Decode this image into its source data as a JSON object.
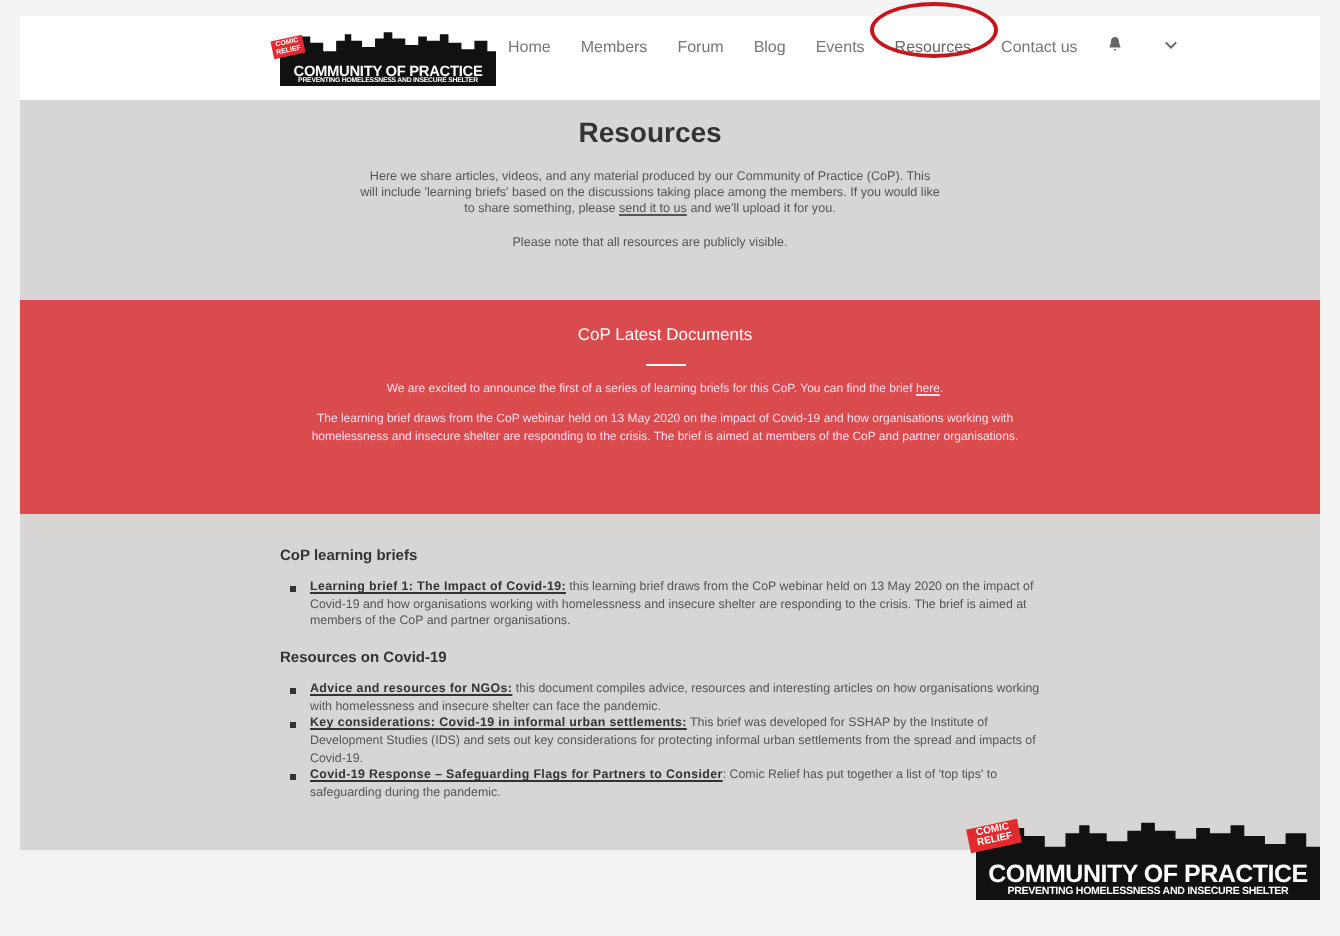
{
  "header": {
    "logo": {
      "badge": "COMIC RELIEF",
      "title": "COMMUNITY OF PRACTICE",
      "subtitle": "PREVENTING HOMELESSNESS AND INSECURE SHELTER"
    },
    "nav": [
      {
        "label": "Home",
        "selected": false,
        "circled": false
      },
      {
        "label": "Members",
        "selected": false,
        "circled": false
      },
      {
        "label": "Forum",
        "selected": false,
        "circled": false
      },
      {
        "label": "Blog",
        "selected": false,
        "circled": false
      },
      {
        "label": "Events",
        "selected": false,
        "circled": false
      },
      {
        "label": "Resources",
        "selected": true,
        "circled": true
      },
      {
        "label": "Contact us",
        "selected": false,
        "circled": false
      }
    ]
  },
  "intro": {
    "title": "Resources",
    "paragraph": {
      "before": "Here we share articles, videos, and any material produced by our Community of Practice (CoP). This will include 'learning briefs' based on the discussions taking place among the members. If you would like to share something, please ",
      "link": "send it to us",
      "after": " and we'll upload it for you."
    },
    "note": "Please note that all resources are publicly visible."
  },
  "banner": {
    "title": "CoP Latest Documents",
    "announcement": {
      "before": "We are excited to announce the first of a series of learning briefs for this CoP. You can find the brief ",
      "link": "here",
      "after": "."
    },
    "description": "The learning brief draws from the CoP webinar held on 13 May 2020 on the impact of Covid-19 and how organisations working with homelessness and insecure shelter are responding to the crisis. The brief is aimed at members of the CoP and partner organisations."
  },
  "sections": [
    {
      "heading": "CoP learning briefs",
      "items": [
        {
          "link": "Learning brief 1: The Impact of Covid-19:",
          "text": " this learning brief draws from the CoP webinar held on 13 May 2020 on the impact of Covid-19 and how organisations working with homelessness and insecure shelter are responding to the crisis. The brief is aimed at members of the CoP and partner organisations."
        }
      ]
    },
    {
      "heading": "Resources on Covid-19",
      "items": [
        {
          "link": "Advice and resources for NGOs:",
          "text": " this document compiles advice, resources and interesting articles on how organisations working with homelessness and insecure shelter can face the pandemic."
        },
        {
          "link": "Key considerations: Covid-19 in informal urban settlements:",
          "text": " This brief was developed for SSHAP by the Institute of Development Studies (IDS) and sets out key considerations for protecting informal urban settlements from the spread and impacts of Covid-19."
        },
        {
          "link": "Covid-19 Response – Safeguarding Flags for Partners to Consider",
          "text": ": Comic Relief has put together a list of 'top tips' to safeguarding during the pandemic."
        }
      ]
    }
  ],
  "corner_logo": {
    "badge": "COMIC RELIEF",
    "title": "COMMUNITY OF PRACTICE",
    "subtitle": "PREVENTING HOMELESSNESS AND INSECURE SHELTER"
  }
}
